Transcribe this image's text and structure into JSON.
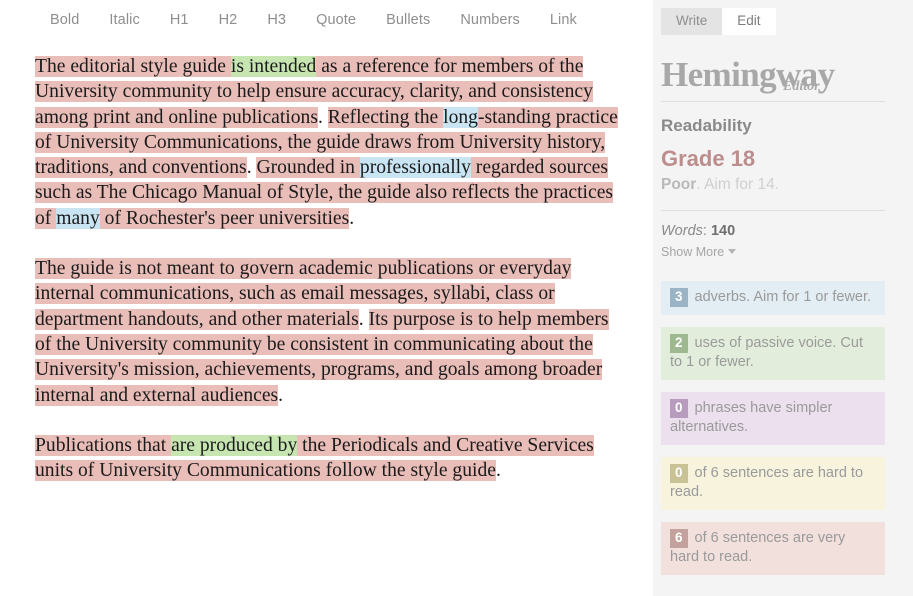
{
  "toolbar": {
    "items": [
      {
        "label": "Bold",
        "name": "bold"
      },
      {
        "label": "Italic",
        "name": "italic"
      },
      {
        "label": "H1",
        "name": "h1"
      },
      {
        "label": "H2",
        "name": "h2"
      },
      {
        "label": "H3",
        "name": "h3"
      },
      {
        "label": "Quote",
        "name": "quote"
      },
      {
        "label": "Bullets",
        "name": "bullets"
      },
      {
        "label": "Numbers",
        "name": "numbers"
      },
      {
        "label": "Link",
        "name": "link"
      }
    ]
  },
  "document": {
    "paragraphs": [
      {
        "runs": [
          {
            "text": "The editorial style guide ",
            "style": "hard"
          },
          {
            "text": "is intended",
            "style": "passive"
          },
          {
            "text": " as a reference for members of the University community to help ensure accuracy, clarity, and consistency among print and online publications",
            "style": "hard"
          },
          {
            "text": ". ",
            "style": "none"
          },
          {
            "text": "Reflecting the ",
            "style": "hard"
          },
          {
            "text": "long",
            "style": "adverb"
          },
          {
            "text": "-standing practice of University Communications, the guide draws from University history, traditions, and conventions",
            "style": "hard"
          },
          {
            "text": ". ",
            "style": "none"
          },
          {
            "text": "Grounded in ",
            "style": "hard"
          },
          {
            "text": "professionally",
            "style": "adverb"
          },
          {
            "text": " regarded sources such as The Chicago Manual of Style, the guide also reflects the practices of ",
            "style": "hard"
          },
          {
            "text": "many",
            "style": "adverb"
          },
          {
            "text": " of Rochester's peer universities",
            "style": "hard"
          },
          {
            "text": ".",
            "style": "none"
          }
        ]
      },
      {
        "runs": [
          {
            "text": "The guide is not meant to govern academic publications or everyday internal communications, such as email messages, syllabi, class or department handouts, and other materials",
            "style": "hard"
          },
          {
            "text": ". ",
            "style": "none"
          },
          {
            "text": "Its purpose is to help members of the University community be consistent in communicating about the University's mission, achievements, programs, and goals among broader internal and external audiences",
            "style": "hard"
          },
          {
            "text": ".",
            "style": "none"
          }
        ]
      },
      {
        "runs": [
          {
            "text": "Publications that ",
            "style": "hard"
          },
          {
            "text": "are produced by",
            "style": "passive"
          },
          {
            "text": " the Periodicals and Creative Services units of University Communications follow the style guide",
            "style": "hard"
          },
          {
            "text": ".",
            "style": "none"
          }
        ]
      }
    ]
  },
  "sidebar": {
    "tabs": [
      {
        "label": "Write",
        "active": false
      },
      {
        "label": "Edit",
        "active": true
      }
    ],
    "logo": {
      "main": "Hemingway",
      "sub": "Editor"
    },
    "readability": {
      "heading": "Readability",
      "grade": "Grade 18",
      "quality": "Poor",
      "aim": ". Aim for 14."
    },
    "words": {
      "label": "Words",
      "separator": ": ",
      "count": "140"
    },
    "show_more": "Show More",
    "stats": [
      {
        "count": "3",
        "text": " adverbs. Aim for 1 or fewer.",
        "card_color": "#e2eef4",
        "badge_color": "#9ab4c6",
        "name": "adverbs"
      },
      {
        "count": "2",
        "text": " uses of passive voice. Cut to 1 or fewer.",
        "card_color": "#e2eedb",
        "badge_color": "#9eb98f",
        "name": "passive-voice"
      },
      {
        "count": "0",
        "text": " phrases have simpler alternatives.",
        "card_color": "#ece0ef",
        "badge_color": "#b79cbd",
        "name": "simpler-alternatives"
      },
      {
        "count": "0",
        "text": " of 6 sentences are hard to read.",
        "card_color": "#f7f3dd",
        "badge_color": "#c8c295",
        "name": "hard-sentences"
      },
      {
        "count": "6",
        "text": " of 6 sentences are very hard to read.",
        "card_color": "#f2e0dd",
        "badge_color": "#c3a29d",
        "name": "very-hard-sentences"
      }
    ]
  },
  "colors": {
    "highlight_very_hard": "#e9bdb8",
    "highlight_hard": "#f2e6a8",
    "highlight_adverb": "#c9e4f2",
    "highlight_passive": "#c6e5b1",
    "highlight_simpler": "#e3c9e8",
    "grade_accent": "#bc8d8d",
    "sidebar_bg": "#f4f4f4"
  }
}
